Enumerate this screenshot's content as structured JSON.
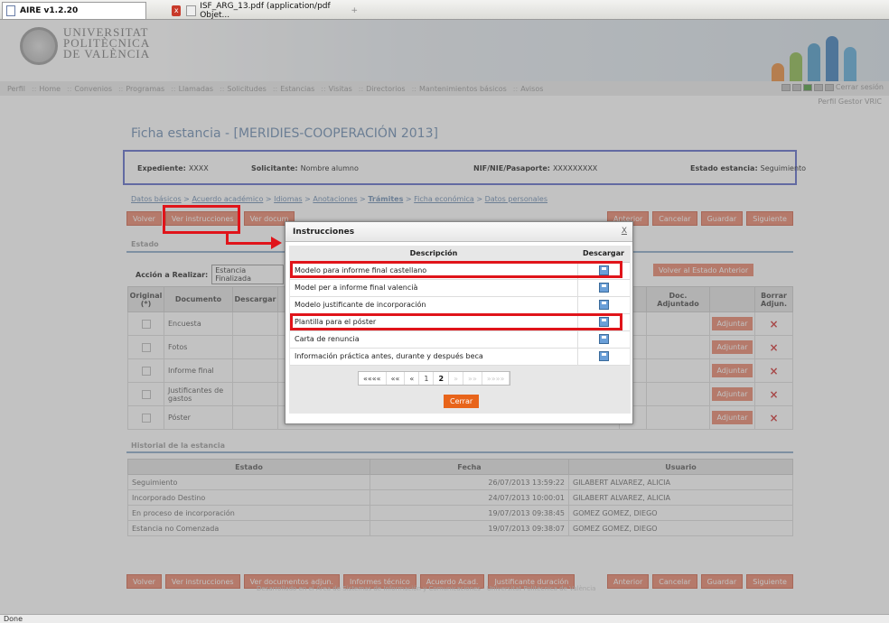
{
  "browser": {
    "active_tab": "AIRE v1.2.20",
    "other_tab": "ISF_ARG_13.pdf (application/pdf Objet...",
    "new_tab": "+"
  },
  "banner": {
    "university_lines": [
      "UNIVERSITAT",
      "POLITÈCNICA",
      "DE VALÈNCIA"
    ]
  },
  "topnav": {
    "items": [
      "Perfil",
      "Home",
      "Convenios",
      "Programas",
      "Llamadas",
      "Solicitudes",
      "Estancias",
      "Visitas",
      "Directorios",
      "Mantenimientos básicos",
      "Avisos"
    ],
    "logout": "Cerrar sesión",
    "profile": "Perfil Gestor VRIC"
  },
  "page": {
    "title": "Ficha estancia - [MERIDIES-COOPERACIÓN 2013]",
    "expediente_label": "Expediente:",
    "expediente_value": "XXXX",
    "solicitante_label": "Solicitante:",
    "solicitante_value": "Nombre alumno",
    "nif_label": "NIF/NIE/Pasaporte:",
    "nif_value": "XXXXXXXXX",
    "estado_label": "Estado estancia:",
    "estado_value": "Seguimiento"
  },
  "breadcrumb": {
    "items": [
      "Datos básicos",
      "Acuerdo académico",
      "Idiomas",
      "Anotaciones",
      "Trámites",
      "Ficha económica",
      "Datos personales"
    ],
    "sep": " > "
  },
  "top_buttons": {
    "volver": "Volver",
    "ver_instrucciones": "Ver instrucciones",
    "ver_documentos": "Ver docum",
    "anterior": "Anterior",
    "cancelar": "Cancelar",
    "guardar": "Guardar",
    "siguiente": "Siguiente"
  },
  "estado_section": {
    "title": "Estado",
    "accion_label": "Acción a Realizar:",
    "accion_value": "Estancia Finalizada",
    "volver_estado": "Volver al Estado Anterior"
  },
  "docs_table": {
    "headers": [
      "Original (*)",
      "Documento",
      "Descargar",
      "do",
      "Doc. Adjuntado",
      "",
      "Borrar Adjun."
    ],
    "rows": [
      "Encuesta",
      "Fotos",
      "Informe final",
      "Justificantes de gastos",
      "Póster"
    ],
    "adjuntar": "Adjuntar",
    "delete_mark": "×"
  },
  "historial": {
    "title": "Historial de la estancia",
    "headers": [
      "Estado",
      "Fecha",
      "Usuario"
    ],
    "rows": [
      {
        "estado": "Seguimiento",
        "fecha": "26/07/2013 13:59:22",
        "usuario": "GILABERT ALVAREZ, ALICIA"
      },
      {
        "estado": "Incorporado Destino",
        "fecha": "24/07/2013 10:00:01",
        "usuario": "GILABERT ALVAREZ, ALICIA"
      },
      {
        "estado": "En proceso de incorporación",
        "fecha": "19/07/2013 09:38:45",
        "usuario": "GOMEZ GOMEZ, DIEGO"
      },
      {
        "estado": "Estancia no Comenzada",
        "fecha": "19/07/2013 09:38:07",
        "usuario": "GOMEZ GOMEZ, DIEGO"
      }
    ]
  },
  "bottom_buttons": [
    "Volver",
    "Ver instrucciones",
    "Ver documentos adjun.",
    "Informes técnico",
    "Acuerdo Acad.",
    "Justificante duración",
    "Anterior",
    "Cancelar",
    "Guardar",
    "Siguiente"
  ],
  "footer": "Desarrollado en el Área de Sistemas de Información y Comunicaciones - Universitat Politècnica de València",
  "modal": {
    "title": "Instrucciones",
    "close": "X",
    "col_descripcion": "Descripción",
    "col_descargar": "Descargar",
    "rows": [
      "Modelo para informe final castellano",
      "Model per a informe final valencià",
      "Modelo justificante de incorporación",
      "Plantilla para el póster",
      "Carta de renuncia",
      "Información práctica antes, durante y después beca"
    ],
    "pager": {
      "first": "««««",
      "prev2": "««",
      "prev": "«",
      "pages": [
        "1",
        "2"
      ],
      "next": "»",
      "next2": "»»",
      "last": "»»»»"
    },
    "cerrar": "Cerrar"
  },
  "status": "Done",
  "colors": {
    "accent": "#e8846a",
    "highlight": "#e0141a",
    "title": "#6a8ab0",
    "frame": "#5a68c8"
  }
}
